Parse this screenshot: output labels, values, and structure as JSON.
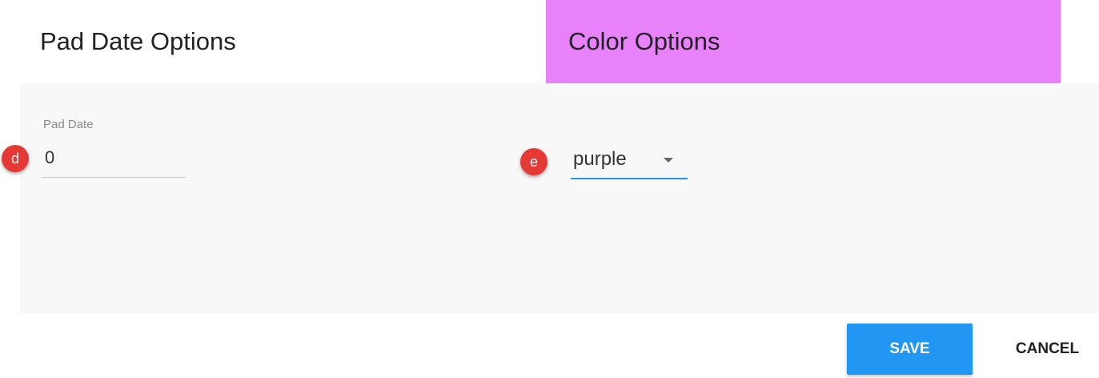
{
  "tabs": {
    "pad_date_title": "Pad Date Options",
    "color_title": "Color Options"
  },
  "pad_date": {
    "label": "Pad Date",
    "value": "0",
    "marker": "d"
  },
  "color": {
    "selected": "purple",
    "marker": "e",
    "icon": "dropdown-arrow-icon"
  },
  "actions": {
    "save_label": "SAVE",
    "cancel_label": "CANCEL"
  },
  "colors": {
    "color_tab_background": "#e882fb",
    "save_button": "#2196f3",
    "focus_underline": "#2196f3",
    "marker": "#e53935",
    "panel_background": "#f8f8f8"
  }
}
